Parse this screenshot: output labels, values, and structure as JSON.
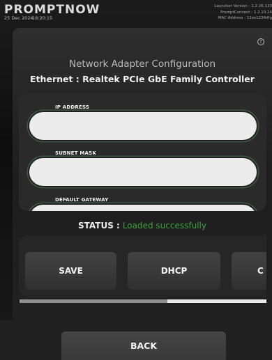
{
  "header": {
    "brand": "PROMPTNOW",
    "date": "25 Dec 2024",
    "time": "18:20:15",
    "launcher_version": "Launcher Version : 1.2.26.133",
    "promptconnect_version": "PromptConnect : 1.2.10.24",
    "mac_address": "MAC Address : 12as1234dfg"
  },
  "page": {
    "title": "Network Adapter Configuration",
    "adapter": "Ethernet : Realtek PCIe GbE Family Controller",
    "help_icon": "help-circle-icon"
  },
  "form": {
    "ip_label": "IP ADDRESS",
    "ip_value": "",
    "subnet_label": "SUBNET MASK",
    "subnet_value": "",
    "gateway_label": "DEFAULT GATEWAY",
    "gateway_value": ""
  },
  "status": {
    "label": "STATUS :",
    "value": "Loaded successfully",
    "value_color": "#3fa33f"
  },
  "actions": {
    "save": "SAVE",
    "dhcp": "DHCP",
    "third_partial": "C",
    "scroll_fraction": 0.6
  },
  "footer": {
    "back": "BACK"
  }
}
